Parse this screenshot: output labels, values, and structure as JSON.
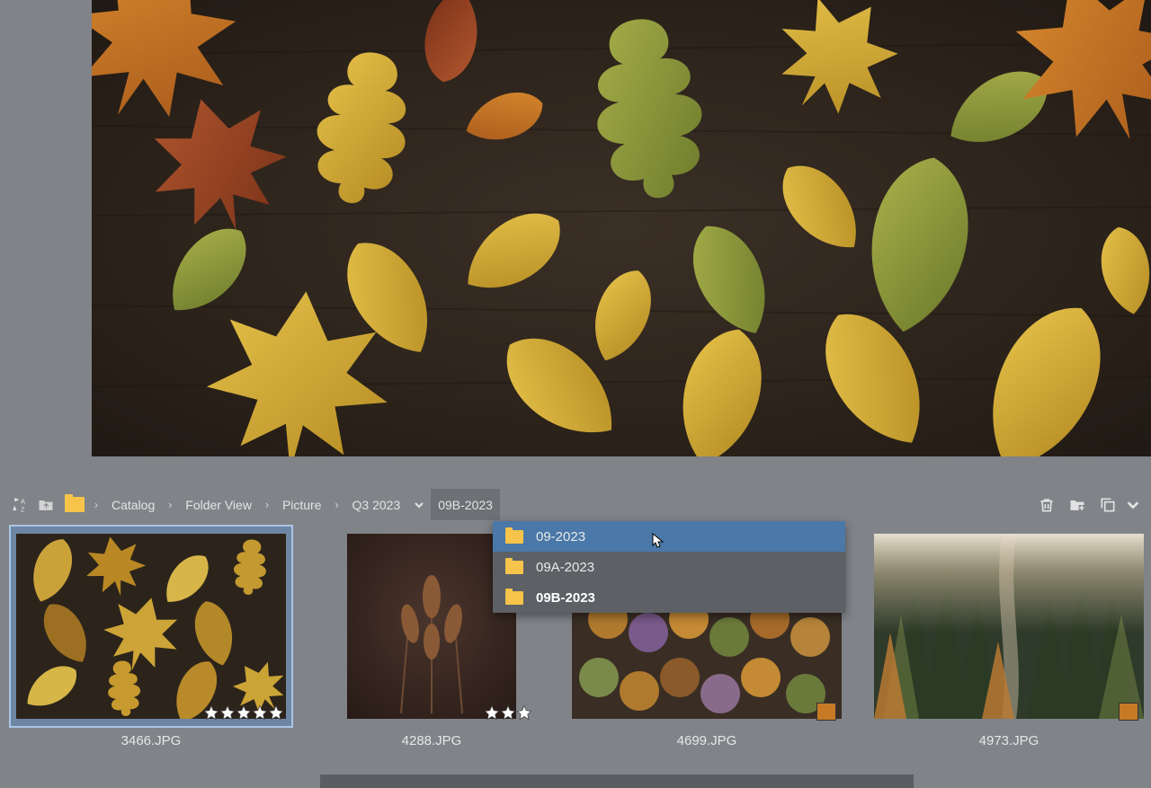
{
  "breadcrumb": {
    "segments": [
      {
        "label": "Catalog"
      },
      {
        "label": "Folder View"
      },
      {
        "label": "Picture"
      },
      {
        "label": "Q3 2023"
      }
    ],
    "current": "09B-2023"
  },
  "dropdown": {
    "items": [
      {
        "label": "09-2023",
        "hover": true,
        "current": false
      },
      {
        "label": "09A-2023",
        "hover": false,
        "current": false
      },
      {
        "label": "09B-2023",
        "hover": false,
        "current": true
      }
    ]
  },
  "thumbnails": [
    {
      "filename": "3466.JPG",
      "stars": 5,
      "color_label": null,
      "selected": true
    },
    {
      "filename": "4288.JPG",
      "stars": 3,
      "color_label": null,
      "selected": false
    },
    {
      "filename": "4699.JPG",
      "stars": 0,
      "color_label": "#c77a25",
      "selected": false
    },
    {
      "filename": "4973.JPG",
      "stars": 0,
      "color_label": "#c77a25",
      "selected": false
    }
  ],
  "icons": {
    "sort": "sort-az-icon",
    "up": "up-folder-icon",
    "trash": "trash-icon",
    "newfolder": "new-folder-icon",
    "copy": "copy-icon"
  }
}
